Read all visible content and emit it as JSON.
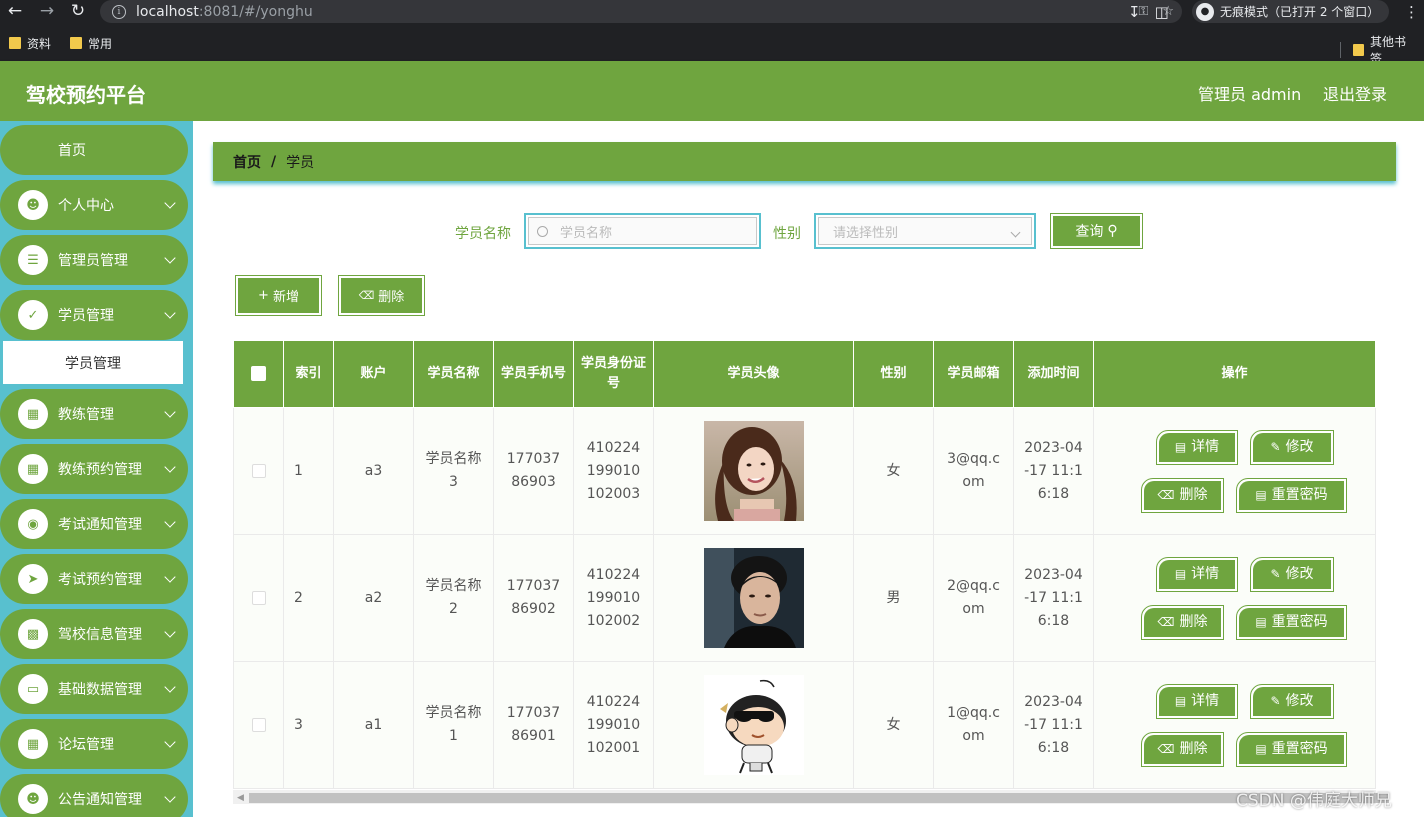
{
  "browser": {
    "url_host": "localhost",
    "url_path": ":8081/#/yonghu",
    "incognito_label": "无痕模式（已打开 2 个窗口）",
    "bookmarks": [
      "资料",
      "常用"
    ],
    "other_bookmarks": "其他书签"
  },
  "header": {
    "title": "驾校预约平台",
    "admin_label": "管理员 admin",
    "logout": "退出登录"
  },
  "sidebar": {
    "items": [
      {
        "label": "首页",
        "icon": "home",
        "expandable": false
      },
      {
        "label": "个人中心",
        "icon": "user-icon",
        "expandable": true
      },
      {
        "label": "管理员管理",
        "icon": "list-icon",
        "expandable": true
      },
      {
        "label": "学员管理",
        "icon": "clipboard-icon",
        "expandable": true
      },
      {
        "label": "教练管理",
        "icon": "grid-icon",
        "expandable": true
      },
      {
        "label": "教练预约管理",
        "icon": "grid-icon",
        "expandable": true
      },
      {
        "label": "考试通知管理",
        "icon": "bulb-icon",
        "expandable": true
      },
      {
        "label": "考试预约管理",
        "icon": "send-icon",
        "expandable": true
      },
      {
        "label": "驾校信息管理",
        "icon": "bar-chart-icon",
        "expandable": true
      },
      {
        "label": "基础数据管理",
        "icon": "monitor-icon",
        "expandable": true
      },
      {
        "label": "论坛管理",
        "icon": "grid-icon",
        "expandable": true
      },
      {
        "label": "公告通知管理",
        "icon": "user-icon",
        "expandable": true
      }
    ],
    "active_submenu": "学员管理"
  },
  "breadcrumb": {
    "home": "首页",
    "sep": "/",
    "current": "学员"
  },
  "search": {
    "name_label": "学员名称",
    "name_placeholder": "学员名称",
    "gender_label": "性别",
    "gender_placeholder": "请选择性别",
    "query_button": "查询"
  },
  "actions": {
    "add": "新增",
    "delete": "删除"
  },
  "table": {
    "headers": [
      "索引",
      "账户",
      "学员名称",
      "学员手机号",
      "学员身份证号",
      "学员头像",
      "性别",
      "学员邮箱",
      "添加时间",
      "操作"
    ],
    "rows": [
      {
        "index": "1",
        "account": "a3",
        "name": "学员名称3",
        "phone": "17703786903",
        "id_card": "410224199010102003",
        "avatar": "woman-photo",
        "gender": "女",
        "email": "3@qq.com",
        "added": "2023-04-17 11:16:18"
      },
      {
        "index": "2",
        "account": "a2",
        "name": "学员名称2",
        "phone": "17703786902",
        "id_card": "410224199010102002",
        "avatar": "man-photo",
        "gender": "男",
        "email": "2@qq.com",
        "added": "2023-04-17 11:16:18"
      },
      {
        "index": "3",
        "account": "a1",
        "name": "学员名称1",
        "phone": "17703786901",
        "id_card": "410224199010102001",
        "avatar": "cartoon-photo",
        "gender": "女",
        "email": "1@qq.com",
        "added": "2023-04-17 11:16:18"
      }
    ],
    "op_labels": {
      "detail": "详情",
      "edit": "修改",
      "delete": "删除",
      "reset": "重置密码"
    }
  },
  "watermark": "CSDN @伟庭大师兄",
  "colors": {
    "primary": "#6fa53f",
    "sidebar": "#58c0cf"
  }
}
